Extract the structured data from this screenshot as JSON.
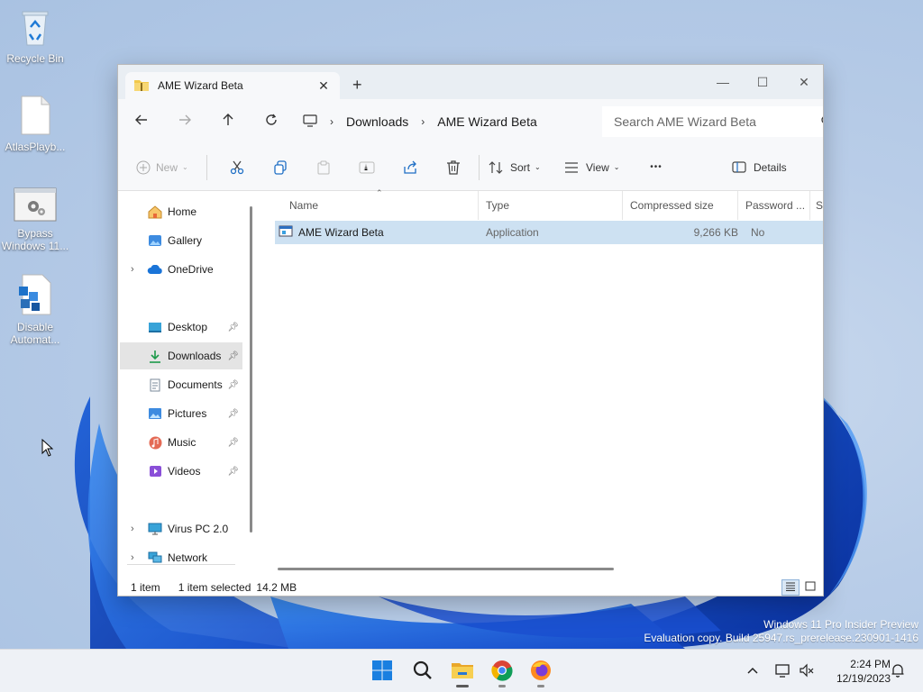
{
  "desktop": {
    "icons": [
      {
        "label": "Recycle Bin"
      },
      {
        "label": "AtlasPlayb..."
      },
      {
        "label_line1": "Bypass",
        "label_line2": "Windows 11..."
      },
      {
        "label_line1": "Disable",
        "label_line2": "Automat..."
      }
    ],
    "watermark_line1": "Windows 11 Pro Insider Preview",
    "watermark_line2": "Evaluation copy. Build 25947.rs_prerelease.230901-1416"
  },
  "window": {
    "tab_title": "AME Wizard Beta",
    "tab_close": "✕",
    "new_tab": "+",
    "minimize": "—",
    "maximize": "☐",
    "close": "✕"
  },
  "address": {
    "path": [
      "Downloads",
      "AME Wizard Beta"
    ],
    "search_placeholder": "Search AME Wizard Beta"
  },
  "toolbar": {
    "new_label": "New",
    "sort_label": "Sort",
    "view_label": "View",
    "more_label": "•••",
    "details_label": "Details"
  },
  "sidebar": {
    "items": [
      {
        "label": "Home"
      },
      {
        "label": "Gallery"
      },
      {
        "label": "OneDrive"
      },
      {
        "label": "Desktop"
      },
      {
        "label": "Downloads"
      },
      {
        "label": "Documents"
      },
      {
        "label": "Pictures"
      },
      {
        "label": "Music"
      },
      {
        "label": "Videos"
      },
      {
        "label": "Virus PC 2.0"
      },
      {
        "label": "Network"
      }
    ]
  },
  "table": {
    "columns": [
      "Name",
      "Type",
      "Compressed size",
      "Password ...",
      "Si"
    ],
    "rows": [
      {
        "name": "AME Wizard Beta",
        "type": "Application",
        "size": "9,266 KB",
        "password": "No"
      }
    ]
  },
  "status": {
    "item_count": "1 item",
    "selected": "1 item selected",
    "size": "14.2 MB"
  },
  "taskbar": {
    "time": "2:24 PM",
    "date": "12/19/2023"
  },
  "colors": {
    "accent": "#0067c0",
    "selection": "#cde1f2"
  }
}
